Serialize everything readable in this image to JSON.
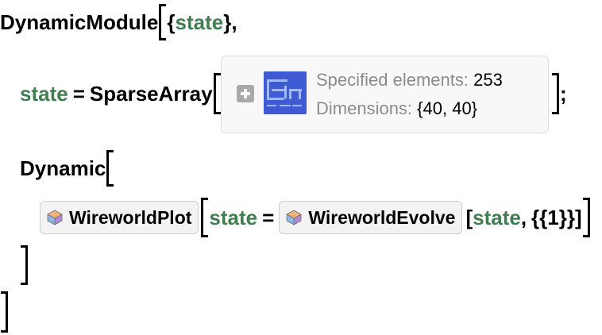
{
  "code": {
    "dynamic_module": "DynamicModule",
    "state": "state",
    "sparse_array": "SparseArray",
    "equals": "=",
    "dynamic": "Dynamic",
    "comma": ",",
    "semicolon": ";",
    "brace_open": "{",
    "brace_close": "}",
    "wireworld_plot": "WireworldPlot",
    "wireworld_evolve": "WireworldEvolve",
    "evolve_arg": "{{1}}"
  },
  "summary_box": {
    "specified_label": "Specified elements:",
    "specified_value": "253",
    "dimensions_label": "Dimensions:",
    "dimensions_value": "{40, 40}"
  },
  "icons": {
    "expand": "plus-icon",
    "resource_function": "cube-icon"
  }
}
